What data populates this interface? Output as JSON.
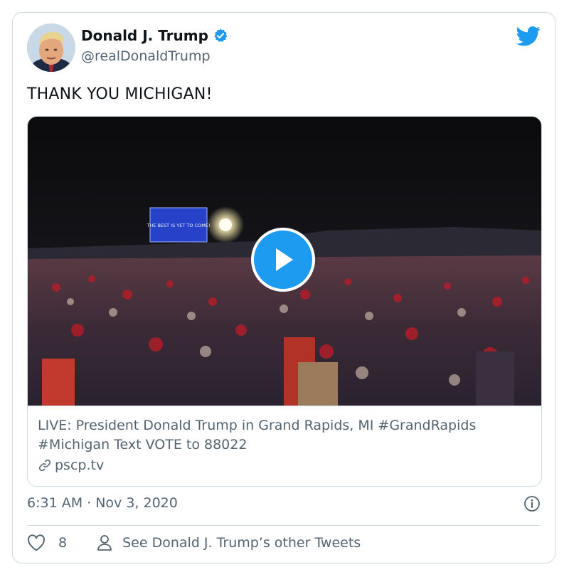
{
  "author": {
    "name": "Donald J. Trump",
    "handle": "@realDonaldTrump",
    "verified_icon": "verified-badge-icon",
    "avatar_icon": "profile-photo"
  },
  "platform_icon": "twitter-bird-icon",
  "tweet": {
    "text": "THANK YOU MICHIGAN!",
    "timestamp": "6:31 AM · Nov 3, 2020",
    "likes": "8",
    "other_tweets_label": "See Donald J. Trump’s other Tweets"
  },
  "media": {
    "screen_text": "THE BEST IS YET TO COME!",
    "play_icon": "play-icon"
  },
  "link_card": {
    "title": "LIVE: President Donald Trump in Grand Rapids, MI #GrandRapids #Michigan Text VOTE to 88022",
    "domain": "pscp.tv"
  },
  "colors": {
    "accent": "#1d9bf0",
    "secondary_text": "#536471",
    "border": "#cfd9de"
  }
}
